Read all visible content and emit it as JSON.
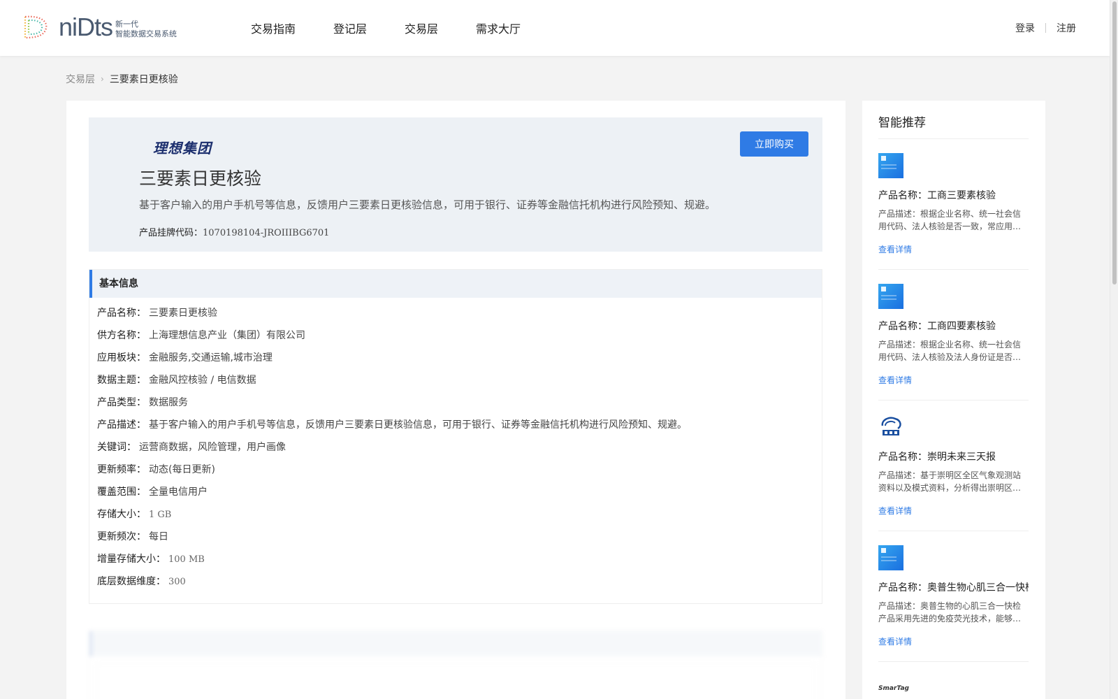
{
  "header": {
    "logo_word": "niDts",
    "logo_sub_line1": "新一代",
    "logo_sub_line2": "智能数据交易系统",
    "nav": [
      "交易指南",
      "登记层",
      "交易层",
      "需求大厅"
    ],
    "login": "登录",
    "register": "注册"
  },
  "breadcrumb": {
    "parent": "交易层",
    "current": "三要素日更核验"
  },
  "hero": {
    "provider_logo_text": "理想集团",
    "title": "三要素日更核验",
    "description": "基于客户输入的用户手机号等信息，反馈用户三要素日更核验信息，可用于银行、证券等金融信托机构进行风险预知、规避。",
    "code_label": "产品挂牌代码：",
    "code_value": "1070198104-JROIIIBG6701",
    "buy_button": "立即购买"
  },
  "basic_info": {
    "heading": "基本信息",
    "rows": [
      {
        "label": "产品名称：",
        "value": "三要素日更核验"
      },
      {
        "label": "供方名称：",
        "value": "上海理想信息产业（集团）有限公司"
      },
      {
        "label": "应用板块：",
        "value": "金融服务,交通运输,城市治理"
      },
      {
        "label": "数据主题：",
        "value": "金融风控核验 / 电信数据"
      },
      {
        "label": "产品类型：",
        "value": "数据服务"
      },
      {
        "label": "产品描述：",
        "value": "基于客户输入的用户手机号等信息，反馈用户三要素日更核验信息，可用于银行、证券等金融信托机构进行风险预知、规避。"
      },
      {
        "label": "关键词：",
        "value": "运营商数据，风险管理，用户画像"
      },
      {
        "label": "更新频率：",
        "value": "动态(每日更新)"
      },
      {
        "label": "覆盖范围：",
        "value": "全量电信用户"
      },
      {
        "label": "存储大小：",
        "value": "1 GB"
      },
      {
        "label": "更新频次：",
        "value": "每日"
      },
      {
        "label": "增量存储大小：",
        "value": "100 MB"
      },
      {
        "label": "底层数据维度：",
        "value": "300"
      }
    ]
  },
  "recommend": {
    "title": "智能推荐",
    "items": [
      {
        "name": "产品名称：工商三要素核验",
        "desc": "产品描述：根据企业名称、统一社会信用代码、法人核验是否一致，常应用…",
        "link": "查看详情",
        "icon": "blue-data-thumbnail"
      },
      {
        "name": "产品名称：工商四要素核验",
        "desc": "产品描述：根据企业名称、统一社会信用代码、法人核验及法人身份证是否…",
        "link": "查看详情",
        "icon": "blue-data-thumbnail"
      },
      {
        "name": "产品名称：崇明未来三天报",
        "desc": "产品描述：基于崇明区全区气象观测站资料以及模式资料，分析得出崇明区…",
        "link": "查看详情",
        "icon": "weather-logo"
      },
      {
        "name": "产品名称：奥普生物心肌三合一快检",
        "desc": "产品描述：奥普生物的心肌三合一快检产品采用先进的免疫荧光技术，能够…",
        "link": "查看详情",
        "icon": "blue-data-thumbnail"
      }
    ],
    "partial_logo_text": "SmarTag"
  },
  "colors": {
    "accent": "#2f7be5",
    "hero_bg": "#edf1f5",
    "page_bg": "#f3f3f3"
  }
}
